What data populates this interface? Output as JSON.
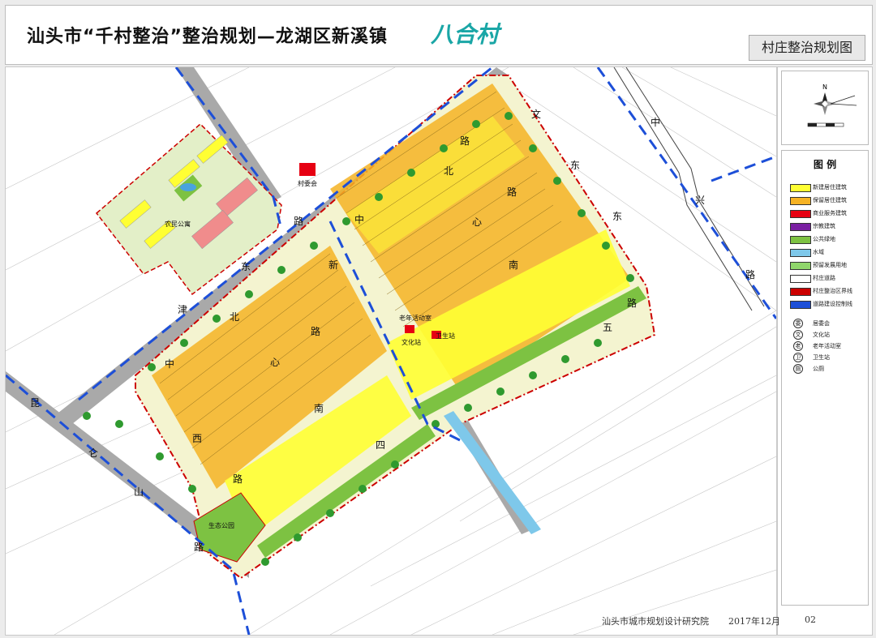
{
  "header": {
    "title": "汕头市“千村整治”整治规划—龙湖区新溪镇",
    "village": "八合村",
    "sheet_name": "村庄整治规划图"
  },
  "map": {
    "places": {
      "farmer_apartment": "农民公寓",
      "village_committee": "村委会",
      "eco_park": "生态公园",
      "culture_station": "文化站",
      "health_station": "卫生站",
      "elder_center": "老年活动室"
    },
    "roads": {
      "wen": "文",
      "dong": "东",
      "lu": "路",
      "zhong": "中",
      "xing": "兴",
      "xin": "新",
      "bei": "北",
      "xin2": "心",
      "nan": "南",
      "wu": "五",
      "jin": "津",
      "xi": "西",
      "kun": "昆",
      "lun": "仑",
      "shan": "山",
      "si": "四"
    }
  },
  "compass": {
    "north": "N"
  },
  "legend": {
    "title": "图 例",
    "items": [
      {
        "label": "新建居住建筑",
        "color": "#ffff33"
      },
      {
        "label": "保留居住建筑",
        "color": "#f5b324"
      },
      {
        "label": "商业服务建筑",
        "color": "#e60012"
      },
      {
        "label": "宗教建筑",
        "color": "#7a1fa2"
      },
      {
        "label": "公共绿地",
        "color": "#7dc242"
      },
      {
        "label": "水域",
        "color": "#7ec8ea"
      },
      {
        "label": "预留发展用地",
        "color": "#8fd66b"
      },
      {
        "label": "村庄道路",
        "color": "#ffffff"
      },
      {
        "label": "村庄整治区界线",
        "color": "#cc0000"
      },
      {
        "label": "道路建设控制线",
        "color": "#1d4fd8"
      }
    ],
    "symbols": [
      {
        "label": "居委会",
        "glyph": "委"
      },
      {
        "label": "文化站",
        "glyph": "文"
      },
      {
        "label": "老年活动室",
        "glyph": "老"
      },
      {
        "label": "卫生站",
        "glyph": "卫"
      },
      {
        "label": "公厕",
        "glyph": "厕"
      }
    ]
  },
  "footer": {
    "institute": "汕头市城市规划设计研究院",
    "date": "2017年12月",
    "page": "02"
  }
}
